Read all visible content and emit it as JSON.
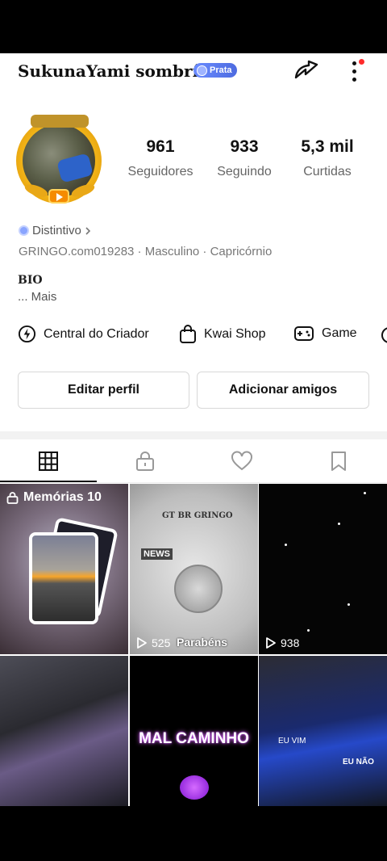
{
  "profile": {
    "username": "SukunaYami sombrío",
    "badge_label": "Prata",
    "stats": [
      {
        "value": "961",
        "label": "Seguidores"
      },
      {
        "value": "933",
        "label": "Seguindo"
      },
      {
        "value": "5,3 mil",
        "label": "Curtidas"
      }
    ],
    "distintivo": "Distintivo",
    "meta": "GRINGO.com019283  ·  Masculino  ·  Capricórnio",
    "bio_title": "BIO",
    "bio_more": "...  Mais"
  },
  "shortcuts": [
    {
      "label": "Central do Criador",
      "icon": "bolt-icon"
    },
    {
      "label": "Kwai Shop",
      "icon": "bag-icon"
    },
    {
      "label": "Game",
      "icon": "gamepad-icon"
    }
  ],
  "buttons": {
    "edit": "Editar perfil",
    "add": "Adicionar amigos"
  },
  "tabs": [
    "grid-icon",
    "lock-icon",
    "heart-icon",
    "bookmark-icon"
  ],
  "grid": {
    "memories_label": "Memórias 10",
    "cell2_title": "GT BR GRINGO",
    "cell2_news": "NEWS",
    "cell2_parabens": "Parabéns",
    "cell2_plays": "525",
    "cell3_plays": "938",
    "cell5_text": "MAL CAMINHO",
    "cell6_text1": "EU VIM",
    "cell6_text2": "EU NÃO"
  }
}
